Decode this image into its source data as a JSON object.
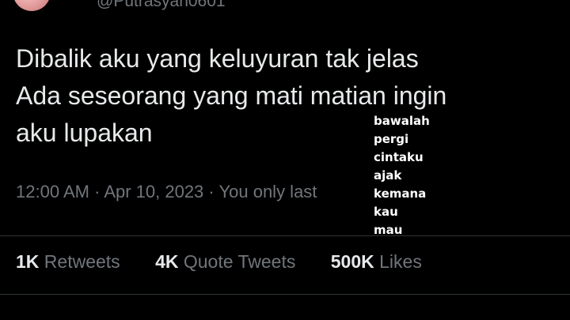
{
  "author": {
    "handle": "@Putrasyan0601"
  },
  "tweet": {
    "lines": [
      "Dibalik aku yang keluyuran tak jelas",
      "Ada seseorang yang mati matian ingin",
      "aku lupakan"
    ],
    "time": "12:00 AM",
    "date": "Apr 10, 2023",
    "audience": "You only last",
    "separator": "·"
  },
  "overlay_words": [
    "bawalah",
    "pergi",
    "cintaku",
    "ajak",
    "kemana",
    "kau",
    "mau"
  ],
  "stats": [
    {
      "count": "1K",
      "label": "Retweets"
    },
    {
      "count": "4K",
      "label": "Quote Tweets"
    },
    {
      "count": "500K",
      "label": "Likes"
    }
  ],
  "colors": {
    "background": "#000000",
    "text_primary": "#e7e9ea",
    "text_secondary": "#71767b",
    "divider": "#2f3336"
  }
}
